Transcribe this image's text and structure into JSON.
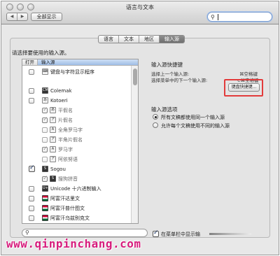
{
  "window": {
    "title": "语言与文本"
  },
  "toolbar": {
    "back": "◀",
    "forward": "▶",
    "show_all": "全部显示",
    "search_icon": "magnifier-icon",
    "search_value": ""
  },
  "tabs": [
    {
      "label": "语言",
      "active": false
    },
    {
      "label": "文本",
      "active": false
    },
    {
      "label": "地区",
      "active": false
    },
    {
      "label": "输入源",
      "active": true
    }
  ],
  "prompt": "请选择要使用的输入源。",
  "list": {
    "col_open": "打开",
    "col_source": "输入源",
    "items": [
      {
        "label": "键盘与字符显示程序",
        "checked": false,
        "icon": "keyboard-viewer-icon",
        "indent": 0
      },
      {
        "label": "Colemak",
        "checked": false,
        "icon": "colemak-icon",
        "indent": 0
      },
      {
        "label": "Kotoeri",
        "checked": false,
        "icon": "kotoeri-icon",
        "indent": 0
      },
      {
        "label": "平假名",
        "checked": true,
        "icon": "hiragana-icon",
        "indent": 1,
        "glyph": "あ"
      },
      {
        "label": "片假名",
        "checked": true,
        "icon": "katakana-icon",
        "indent": 1,
        "glyph": "ア"
      },
      {
        "label": "全角罗马字",
        "checked": false,
        "icon": "fullwidth-roman-icon",
        "indent": 1,
        "glyph": "A"
      },
      {
        "label": "半角片假名",
        "checked": false,
        "icon": "halfwidth-katakana-icon",
        "indent": 1,
        "glyph": "ア"
      },
      {
        "label": "罗马字",
        "checked": true,
        "icon": "romaji-icon",
        "indent": 1,
        "glyph": "A"
      },
      {
        "label": "阿依努语",
        "checked": false,
        "icon": "ainu-icon",
        "indent": 1,
        "glyph": "ア"
      },
      {
        "label": "Sogou",
        "checked": true,
        "icon": "sogou-icon",
        "indent": 0,
        "glyph": "S"
      },
      {
        "label": "搜狗拼音",
        "checked": true,
        "icon": "sogou-pinyin-icon",
        "indent": 1,
        "glyph": "S"
      },
      {
        "label": "Unicode 十六进制输入",
        "checked": false,
        "icon": "unicode-hex-icon",
        "indent": 0,
        "glyph": "U+"
      },
      {
        "label": "阿富汗达里文",
        "checked": false,
        "icon": "afghan-flag-icon",
        "indent": 0
      },
      {
        "label": "阿富汗普什图文",
        "checked": false,
        "icon": "afghan-flag-icon",
        "indent": 0
      },
      {
        "label": "阿富汗乌兹别克文",
        "checked": false,
        "icon": "afghan-flag-icon",
        "indent": 0
      }
    ]
  },
  "shortcuts": {
    "heading": "输入源快捷键",
    "prev_label": "选择上一个输入源:",
    "prev_key": "⌘空格键",
    "next_label": "选择菜单中的下一个输入源:",
    "next_key": "⌥⌘空格键",
    "button": "键盘快捷键..."
  },
  "options": {
    "heading": "输入源选项",
    "radio_all": "所有文稿都使用同一个输入源",
    "radio_each": "允许每个文稿使用不同的输入源",
    "selected": "all"
  },
  "bottom": {
    "show_in_menubar": "在菜单栏中显示输",
    "show_in_menubar_checked": true
  },
  "watermark": "www.qinpinchang.com",
  "colors": {
    "highlight": "#e23b3b",
    "watermark": "#d61c7c",
    "tab_active": "#7a7a7a"
  }
}
